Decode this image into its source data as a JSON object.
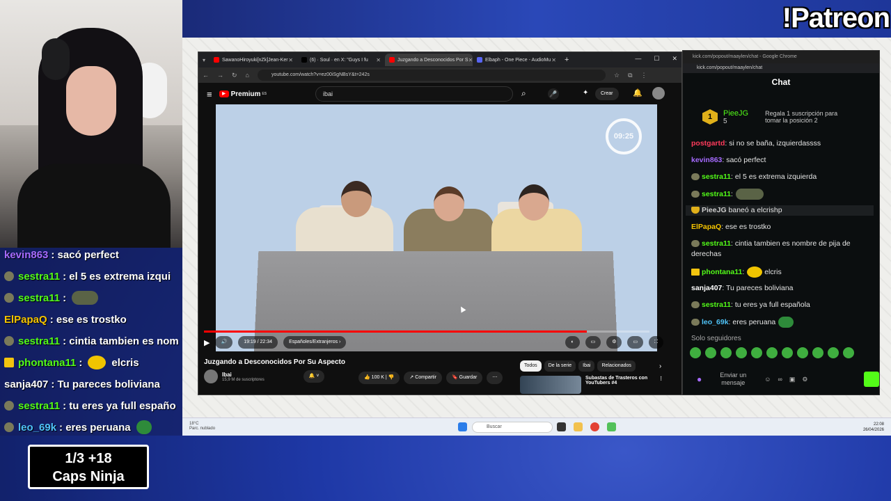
{
  "overlay": {
    "patreon": "!Patreon",
    "caps_line1": "1/3   +18",
    "caps_line2": "Caps Ninja",
    "chat": [
      {
        "user": "kevin863",
        "color": "#a66bff",
        "text": ": sacó perfect",
        "icon": "none",
        "emote": ""
      },
      {
        "user": "sestra11",
        "color": "#53fc18",
        "text": ": el 5 es extrema izqui",
        "icon": "badge",
        "emote": ""
      },
      {
        "user": "sestra11",
        "color": "#53fc18",
        "text": ":",
        "icon": "badge",
        "emote": "frog"
      },
      {
        "user": "ElPapaQ",
        "color": "#f5c400",
        "text": ": ese es trostko",
        "icon": "none",
        "emote": ""
      },
      {
        "user": "sestra11",
        "color": "#53fc18",
        "text": ": cintia tambien es nom",
        "icon": "badge",
        "emote": ""
      },
      {
        "user": "phontana11",
        "color": "#53fc18",
        "text": ":",
        "icon": "crown",
        "emote": "yellow",
        "after": "elcris"
      },
      {
        "user": "sanja407",
        "color": "#ffffff",
        "text": ": Tu pareces boliviana",
        "icon": "none",
        "emote": ""
      },
      {
        "user": "sestra11",
        "color": "#53fc18",
        "text": ": tu eres ya full españo",
        "icon": "badge",
        "emote": ""
      },
      {
        "user": "leo_69k",
        "color": "#4fc3f7",
        "text": ": eres peruana",
        "icon": "badge",
        "emote": "green"
      }
    ]
  },
  "browser": {
    "tabs": [
      {
        "label": "SawanoHiroyuki[nZk]Jean-Ker",
        "active": false
      },
      {
        "label": "(6) · Soul · en X: \"Guys I fu",
        "active": false
      },
      {
        "label": "Juzgando a Desconocidos Por S",
        "active": true
      },
      {
        "label": "Elbaph - One Piece - AudioMu",
        "active": false
      }
    ],
    "url": "youtube.com/watch?v=ez00iSgNBsY&t=242s",
    "yt_logo": "Premium",
    "yt_region": "ES",
    "search_value": "ibai",
    "create_label": "Crear",
    "timer": "09:25",
    "time_display": "19:19 / 22:34",
    "subtitle_label": "Españoles/Extranjeros",
    "progress": 0.86,
    "video_title": "Juzgando a Desconocidos Por Su Aspecto",
    "channel_name": "Ibai",
    "subscribers": "15,9 M de suscriptores",
    "likes": "100 K",
    "share": "Compartir",
    "save": "Guardar",
    "chips": [
      "Todos",
      "De la serie",
      "Ibai",
      "Relacionados"
    ],
    "rec_title_1": "Subastas de Trasteros con",
    "rec_title_2": "YouTubers #4"
  },
  "kick": {
    "window_title": "kick.com/popout/maaylen/chat - Google Chrome",
    "url": "kick.com/popout/maaylen/chat",
    "title": "Chat",
    "pinned_rank": "1",
    "pinned_user": "PieeJG",
    "pinned_count": "5",
    "gift_line1": "Regala 1 suscripción para",
    "gift_line2": "tomar la posición 2",
    "messages": [
      {
        "user": "postgartd",
        "color": "#ff3b5c",
        "text": ": si no se baña, izquierdassss",
        "icon": "",
        "emote": ""
      },
      {
        "user": "kevin863",
        "color": "#a66bff",
        "text": ": sacó perfect",
        "icon": "",
        "emote": ""
      },
      {
        "user": "sestra11",
        "color": "#53fc18",
        "text": ": el 5 es extrema izquierda",
        "icon": "badge",
        "emote": ""
      },
      {
        "user": "sestra11",
        "color": "#53fc18",
        "text": ":",
        "icon": "badge",
        "emote": "frog"
      },
      {
        "user": "PieeJG",
        "color": "#cccccc",
        "text": " baneó a elcrishp",
        "icon": "shield",
        "emote": "",
        "mod": true
      },
      {
        "user": "ElPapaQ",
        "color": "#f5c400",
        "text": ": ese es trostko",
        "icon": "",
        "emote": ""
      },
      {
        "user": "sestra11",
        "color": "#53fc18",
        "text": ": cintia tambien es nombre de pija de derechas",
        "icon": "badge",
        "emote": ""
      },
      {
        "user": "phontana11",
        "color": "#53fc18",
        "text": ":",
        "icon": "crown",
        "emote": "yellow",
        "after": " elcris"
      },
      {
        "user": "sanja407",
        "color": "#ffffff",
        "text": ": Tu pareces boliviana",
        "icon": "",
        "emote": ""
      },
      {
        "user": "sestra11",
        "color": "#53fc18",
        "text": ": tu eres ya full española",
        "icon": "badge",
        "emote": ""
      },
      {
        "user": "leo_69k",
        "color": "#4fc3f7",
        "text": ": eres peruana",
        "icon": "badge",
        "emote": "green"
      }
    ],
    "followers_only": "Solo seguidores",
    "input_placeholder": "Enviar un mensaje"
  },
  "taskbar": {
    "weather_temp": "18°C",
    "weather_desc": "Parc. nublado",
    "search": "Buscar",
    "time": "22:08",
    "date": "26/04/2026"
  }
}
